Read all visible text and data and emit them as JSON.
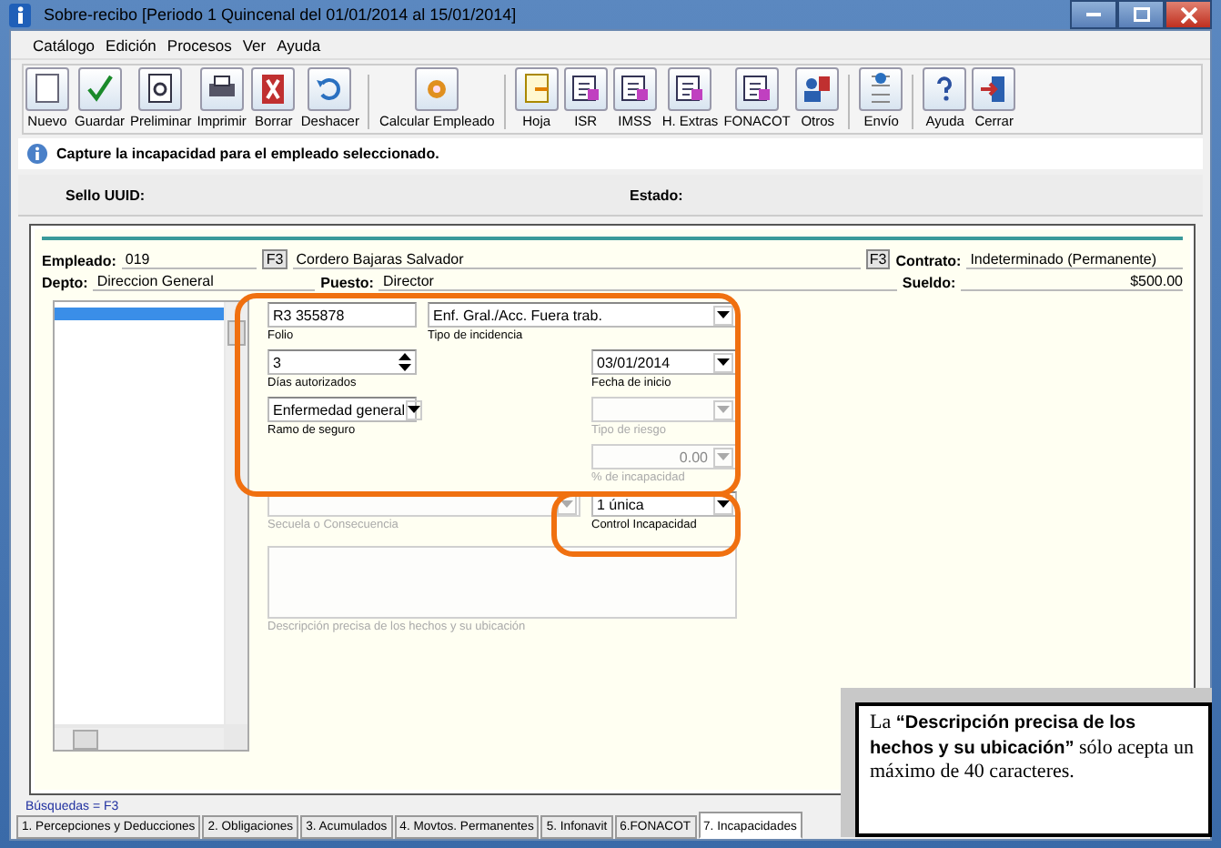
{
  "window": {
    "title": "Sobre-recibo  [Periodo 1 Quincenal del 01/01/2014 al 15/01/2014]"
  },
  "menu": [
    "Catálogo",
    "Edición",
    "Procesos",
    "Ver",
    "Ayuda"
  ],
  "toolbar": [
    "Nuevo",
    "Guardar",
    "Preliminar",
    "Imprimir",
    "Borrar",
    "Deshacer",
    "Calcular Empleado",
    "Hoja",
    "ISR",
    "IMSS",
    "H. Extras",
    "FONACOT",
    "Otros",
    "Envío",
    "Ayuda",
    "Cerrar"
  ],
  "info_message": "Capture la incapacidad para el empleado seleccionado.",
  "stamp": {
    "uuid_label": "Sello UUID:",
    "state_label": "Estado:"
  },
  "employee": {
    "label": "Empleado:",
    "number": "019",
    "lookup_key": "F3",
    "name": "Cordero Bajaras Salvador",
    "contract_lookup_key": "F3",
    "contract_label": "Contrato:",
    "contract": "Indeterminado (Permanente)",
    "dept_label": "Depto:",
    "dept": "Direccion General",
    "position_label": "Puesto:",
    "position": "Director",
    "salary_label": "Sueldo:",
    "salary": "$500.00"
  },
  "list_rows": [
    {
      "selected": true
    }
  ],
  "fields": [
    {
      "label": "Folio",
      "value": "R3 355878",
      "kind": "text",
      "disabled": false
    },
    {
      "label": "Tipo de incidencia",
      "value": "Enf. Gral./Acc. Fuera trab.",
      "kind": "combo",
      "disabled": false
    },
    {
      "label": "Días autorizados",
      "value": "3",
      "kind": "spin",
      "disabled": false
    },
    {
      "label": "Fecha de inicio",
      "value": "03/01/2014",
      "kind": "combo",
      "disabled": false
    },
    {
      "label": "Ramo de seguro",
      "value": "Enfermedad general",
      "kind": "combo",
      "disabled": false
    },
    {
      "label": "Tipo de riesgo",
      "kind": "combo",
      "disabled": true
    },
    {
      "label": "% de incapacidad",
      "value": "0.00",
      "kind": "combo",
      "disabled": true
    },
    {
      "label": "Secuela o Consecuencia",
      "kind": "combo",
      "disabled": true
    },
    {
      "label": "Control Incapacidad",
      "value": "1 única",
      "kind": "combo",
      "disabled": false
    },
    {
      "label": "Descripción precisa de los hechos y su ubicación",
      "kind": "textarea",
      "disabled": true
    }
  ],
  "search_hint": "Búsquedas = F3",
  "tabs": [
    {
      "label": "1. Percepciones y Deducciones",
      "selected": false
    },
    {
      "label": "2. Obligaciones",
      "selected": false
    },
    {
      "label": "3. Acumulados",
      "selected": false
    },
    {
      "label": "4. Movtos. Permanentes",
      "selected": false
    },
    {
      "label": "5. Infonavit",
      "selected": false
    },
    {
      "label": "6.FONACOT",
      "selected": false
    },
    {
      "label": "7. Incapacidades",
      "selected": true
    }
  ],
  "callout": "La **“Descripción precisa de los hechos y su ubicación”** sólo acepta un máximo de 40 caracteres."
}
